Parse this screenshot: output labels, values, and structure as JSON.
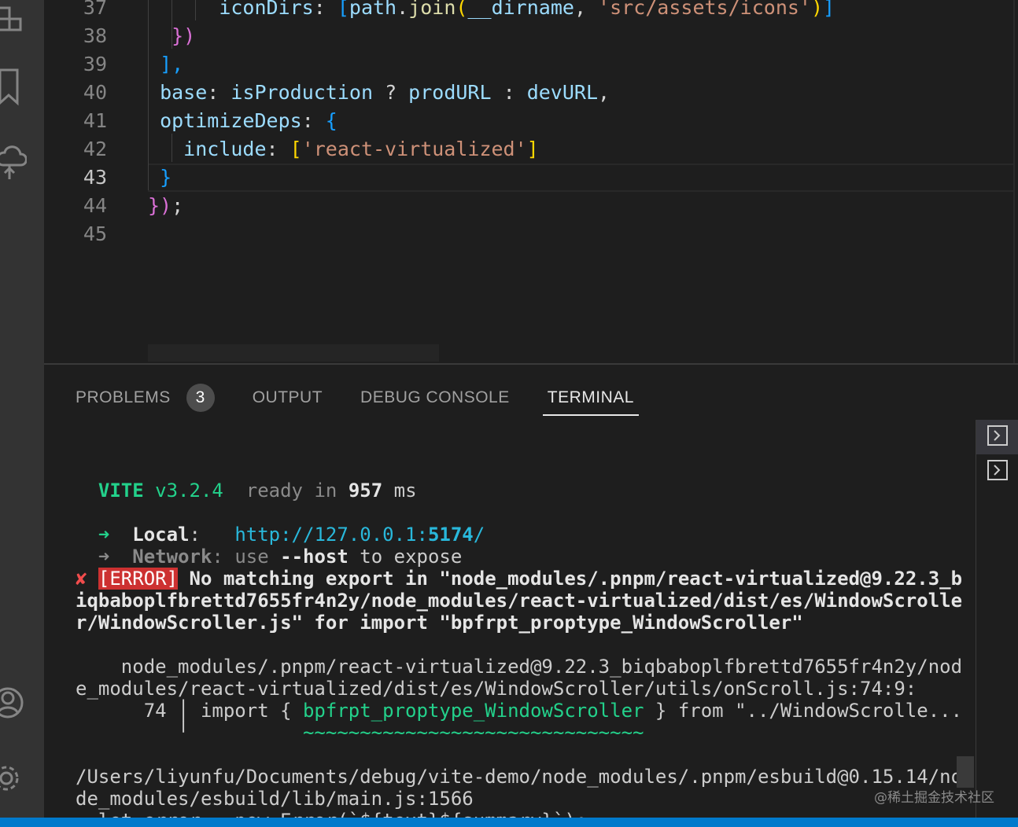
{
  "editor": {
    "lines": [
      {
        "num": "37",
        "tokens": [
          {
            "t": "      ",
            "c": "k-white"
          },
          {
            "t": "iconDirs",
            "c": "k-prop"
          },
          {
            "t": ": ",
            "c": "k-white"
          },
          {
            "t": "[",
            "c": "k-br"
          },
          {
            "t": "path",
            "c": "k-blue"
          },
          {
            "t": ".",
            "c": "k-white"
          },
          {
            "t": "join",
            "c": "k-fn"
          },
          {
            "t": "(",
            "c": "k-yel"
          },
          {
            "t": "__dirname",
            "c": "k-blue"
          },
          {
            "t": ", ",
            "c": "k-white"
          },
          {
            "t": "'src/assets/icons'",
            "c": "k-str"
          },
          {
            "t": ")",
            "c": "k-yel"
          },
          {
            "t": "]",
            "c": "k-br"
          }
        ]
      },
      {
        "num": "38",
        "tokens": [
          {
            "t": "  ",
            "c": "k-white"
          },
          {
            "t": "})",
            "c": "k-pur"
          }
        ]
      },
      {
        "num": "39",
        "tokens": [
          {
            "t": " ",
            "c": "k-white"
          },
          {
            "t": "],",
            "c": "k-br"
          }
        ]
      },
      {
        "num": "40",
        "tokens": [
          {
            "t": " ",
            "c": "k-white"
          },
          {
            "t": "base",
            "c": "k-prop"
          },
          {
            "t": ": ",
            "c": "k-white"
          },
          {
            "t": "isProduction",
            "c": "k-blue"
          },
          {
            "t": " ? ",
            "c": "k-white"
          },
          {
            "t": "prodURL",
            "c": "k-blue"
          },
          {
            "t": " : ",
            "c": "k-white"
          },
          {
            "t": "devURL",
            "c": "k-blue"
          },
          {
            "t": ",",
            "c": "k-white"
          }
        ]
      },
      {
        "num": "41",
        "tokens": [
          {
            "t": " ",
            "c": "k-white"
          },
          {
            "t": "optimizeDeps",
            "c": "k-prop"
          },
          {
            "t": ": ",
            "c": "k-white"
          },
          {
            "t": "{",
            "c": "k-br"
          }
        ]
      },
      {
        "num": "42",
        "tokens": [
          {
            "t": "   ",
            "c": "k-white"
          },
          {
            "t": "include",
            "c": "k-prop"
          },
          {
            "t": ": ",
            "c": "k-white"
          },
          {
            "t": "[",
            "c": "k-yel"
          },
          {
            "t": "'react-virtualized'",
            "c": "k-str"
          },
          {
            "t": "]",
            "c": "k-yel"
          }
        ]
      },
      {
        "num": "43",
        "tokens": [
          {
            "t": " ",
            "c": "k-white"
          },
          {
            "t": "}",
            "c": "k-br"
          }
        ]
      },
      {
        "num": "44",
        "tokens": [
          {
            "t": "})",
            "c": "k-pur"
          },
          {
            "t": ";",
            "c": "k-white"
          }
        ]
      },
      {
        "num": "45",
        "tokens": []
      }
    ]
  },
  "panel": {
    "tabs": [
      {
        "label": "PROBLEMS",
        "badge": "3"
      },
      {
        "label": "OUTPUT"
      },
      {
        "label": "DEBUG CONSOLE"
      },
      {
        "label": "TERMINAL",
        "active": true
      }
    ]
  },
  "terminal": {
    "lines": [
      [],
      [
        {
          "t": "  "
        },
        {
          "t": "VITE",
          "c": "t-green"
        },
        {
          "t": " v3.2.4",
          "c": "t-green-n"
        },
        {
          "t": "  ready in ",
          "c": "t-dim"
        },
        {
          "t": "957",
          "c": "t-bold"
        },
        {
          "t": " ms"
        }
      ],
      [],
      [
        {
          "t": "  "
        },
        {
          "t": "➜",
          "c": "t-green-n"
        },
        {
          "t": "  "
        },
        {
          "t": "Local",
          "c": "t-bold"
        },
        {
          "t": ":   "
        },
        {
          "t": "http://127.0.0.1:",
          "c": "t-cyan"
        },
        {
          "t": "5174",
          "c": "t-cyan-b"
        },
        {
          "t": "/",
          "c": "t-cyan"
        }
      ],
      [
        {
          "t": "  "
        },
        {
          "t": "➜",
          "c": "t-dim"
        },
        {
          "t": "  "
        },
        {
          "t": "Network",
          "c": "t-dimb"
        },
        {
          "t": ": use ",
          "c": "t-dim"
        },
        {
          "t": "--host",
          "c": "t-bold"
        },
        {
          "t": " to expose"
        }
      ],
      [
        {
          "t": "✘",
          "c": "t-red"
        },
        {
          "t": " "
        },
        {
          "t": "[ERROR]",
          "c": "t-errbg"
        },
        {
          "t": " No matching export in \"node_modules/.pnpm/react-virtualized@9.22.3_b",
          "c": "t-bold"
        }
      ],
      [
        {
          "t": "iqbaboplfbrettd7655fr4n2y/node_modules/react-virtualized/dist/es/WindowScrolle",
          "c": "t-bold"
        }
      ],
      [
        {
          "t": "r/WindowScroller.js\" for import \"bpfrpt_proptype_WindowScroller\"",
          "c": "t-bold"
        }
      ],
      [],
      [
        {
          "t": "    node_modules/.pnpm/react-virtualized@9.22.3_biqbaboplfbrettd7655fr4n2y/nod"
        }
      ],
      [
        {
          "t": "e_modules/react-virtualized/dist/es/WindowScroller/utils/onScroll.js:74:9:"
        }
      ],
      [
        {
          "t": "      74 │ import { "
        },
        {
          "t": "bpfrpt_proptype_WindowScroller",
          "c": "t-green-n"
        },
        {
          "t": " } from \"../WindowScrolle..."
        }
      ],
      [
        {
          "t": "         ╵          "
        },
        {
          "t": "~~~~~~~~~~~~~~~~~~~~~~~~~~~~~~",
          "c": "t-wave"
        }
      ],
      [],
      [
        {
          "t": "/Users/liyunfu/Documents/debug/vite-demo/node_modules/.pnpm/esbuild@0.15.14/no"
        }
      ],
      [
        {
          "t": "de_modules/esbuild/lib/main.js:1566"
        }
      ],
      [
        {
          "t": "  let error = new Error(`${text}${summary}`);"
        }
      ]
    ]
  },
  "watermark": "@稀土掘金技术社区",
  "icons": {
    "activity": [
      "extensions-icon",
      "bookmark-icon",
      "remote-explorer-icon",
      "account-icon",
      "settings-gear-icon"
    ],
    "panel": [
      "terminal-icon",
      "terminal-icon"
    ]
  }
}
